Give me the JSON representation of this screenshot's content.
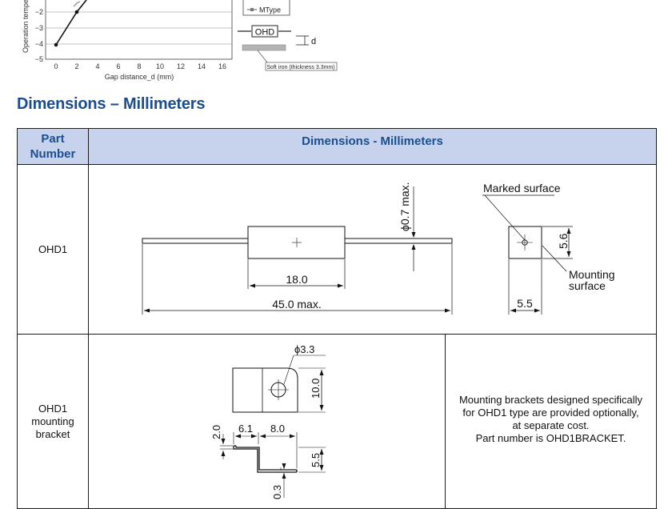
{
  "graph": {
    "y_axis_label": "Operation tempe",
    "y_ticks": [
      "−2",
      "−3",
      "−4",
      "−5"
    ],
    "x_ticks": [
      "0",
      "2",
      "4",
      "6",
      "8",
      "10",
      "12",
      "14",
      "16"
    ],
    "x_axis_label": "Gap distance_d (mm)",
    "legend_label": "MType",
    "setup_sensor_label": "OHD",
    "setup_gap_label": "d",
    "setup_iron_label": "Soft iron (thickness 3.3mm)"
  },
  "section_title": "Dimensions – Millimeters",
  "table": {
    "headers": {
      "part_number": "Part Number",
      "dimensions": "Dimensions - Millimeters"
    },
    "rows": [
      {
        "part_number": "OHD1",
        "drawing": {
          "dia_label": "ϕ0.7 max.",
          "body_length": "18.0",
          "total_length": "45.0 max.",
          "marked_surface": "Marked surface",
          "mounting_surface_1": "Mounting",
          "mounting_surface_2": "surface",
          "height": "5.6",
          "width": "5.5"
        }
      },
      {
        "part_number_lines": [
          "OHD1",
          "mounting",
          "bracket"
        ],
        "drawing": {
          "hole": "ϕ3.3",
          "height": "10.0",
          "w1": "6.1",
          "w2": "8.0",
          "t1": "2.0",
          "t2": "5.5",
          "t3": "0.3"
        },
        "note_lines": [
          "Mounting brackets designed specifically",
          "for OHD1 type are provided optionally,",
          "at separate cost.",
          "Part number is OHD1BRACKET."
        ]
      }
    ]
  }
}
